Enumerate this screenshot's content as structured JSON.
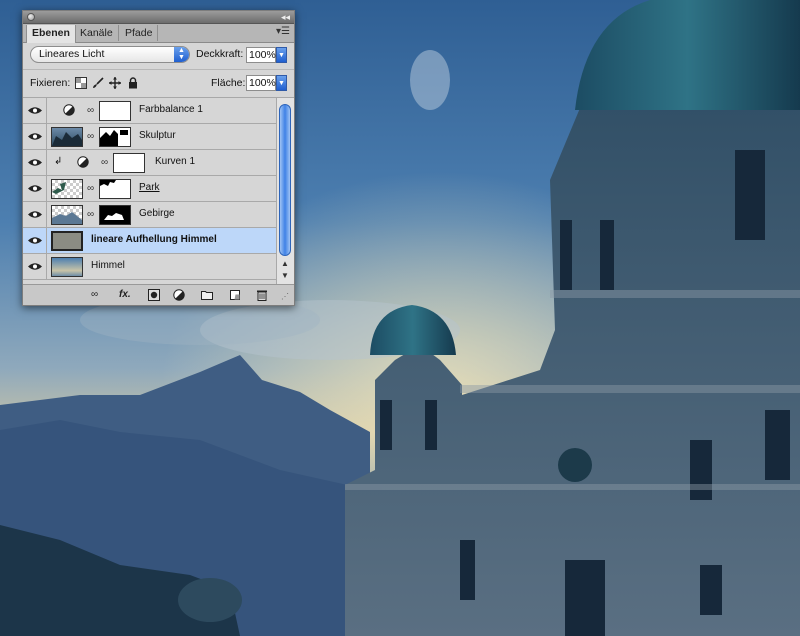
{
  "panel": {
    "tabs": [
      {
        "label": "Ebenen",
        "active": true
      },
      {
        "label": "Kanäle",
        "active": false
      },
      {
        "label": "Pfade",
        "active": false
      }
    ],
    "blend_mode": "Lineares Licht",
    "opacity_label": "Deckkraft:",
    "opacity_value": "100%",
    "lock_label": "Fixieren:",
    "fill_label": "Fläche:",
    "fill_value": "100%",
    "layers": [
      {
        "name": "Farbbalance 1",
        "kind": "adjustment",
        "adj_icon": "half-circle-icon",
        "mask": "white-mask"
      },
      {
        "name": "Skulptur",
        "kind": "image",
        "mask": "sculpture-mask"
      },
      {
        "name": "Kurven 1",
        "kind": "adjustment-clipped",
        "adj_icon": "half-circle-icon",
        "mask": "white-mask"
      },
      {
        "name": "Park",
        "kind": "image",
        "mask": "park-mask"
      },
      {
        "name": "Gebirge",
        "kind": "image",
        "mask": "mountain-mask"
      },
      {
        "name": "lineare Aufhellung Himmel",
        "kind": "fill",
        "selected": true
      },
      {
        "name": "Himmel",
        "kind": "image"
      }
    ],
    "accent_color": "#3f82e6",
    "selected_row_color": "#bdd7f9"
  }
}
